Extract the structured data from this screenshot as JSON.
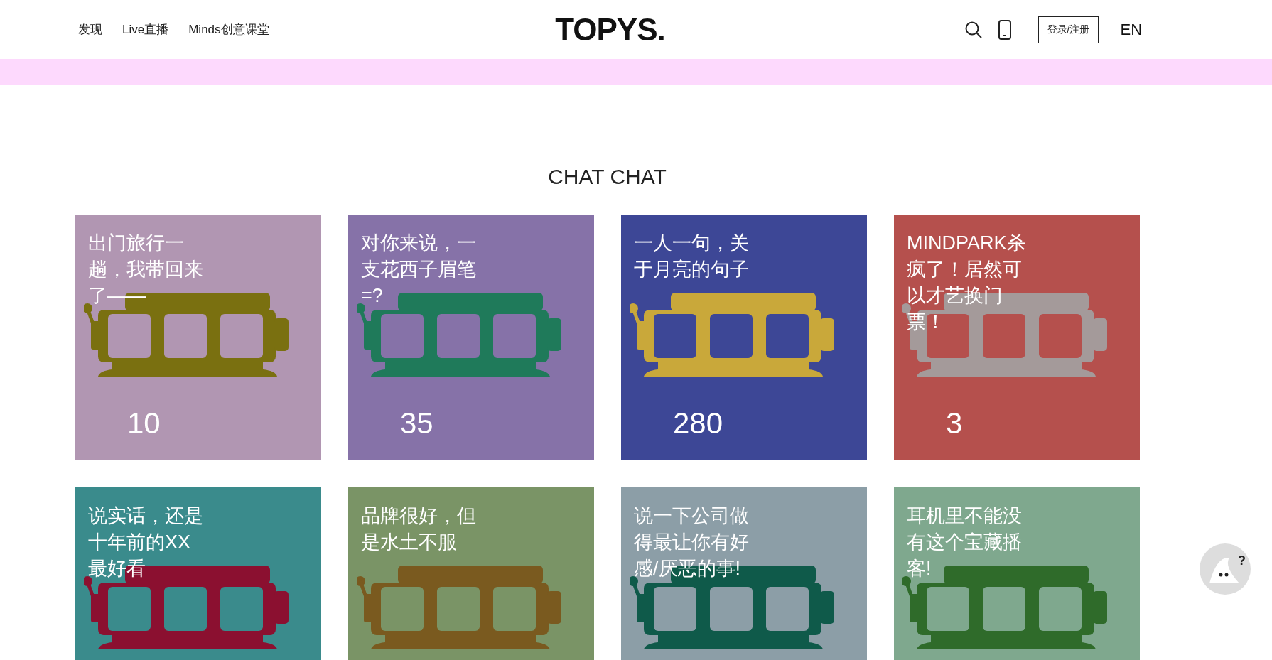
{
  "header": {
    "nav": [
      {
        "label": "发现"
      },
      {
        "label": "Live直播"
      },
      {
        "label": "Minds创意课堂"
      }
    ],
    "logo": "TOPYS.",
    "login": "登录/注册",
    "language": "EN"
  },
  "section": {
    "title": "CHAT CHAT"
  },
  "cards": [
    {
      "title": "出门旅行一趟，我带回来了——",
      "count": "10",
      "color": "#b196b2",
      "machine": {
        "color": "#7a7010"
      }
    },
    {
      "title": "对你来说，一支花西子眉笔=?",
      "count": "35",
      "color": "#8672a8",
      "machine": {
        "color": "#1f7a5a"
      }
    },
    {
      "title": "一人一句，关于月亮的句子",
      "count": "280",
      "color": "#3d4796",
      "machine": {
        "color": "#c9a83a"
      }
    },
    {
      "title": "MINDPARK杀疯了！居然可以才艺换门票！",
      "count": "3",
      "color": "#b5504d",
      "machine": {
        "color": "#a49a9a"
      }
    },
    {
      "title": "说实话，还是十年前的XX最好看",
      "color": "#3a8b8c",
      "machine": {
        "color": "#8b1030"
      }
    },
    {
      "title": "品牌很好，但是水土不服",
      "color": "#7a9466",
      "machine": {
        "color": "#7a5a1f"
      }
    },
    {
      "title": "说一下公司做得最让你有好感/厌恶的事!",
      "color": "#8c9ea7",
      "machine": {
        "color": "#0f5a4a"
      }
    },
    {
      "title": "耳机里不能没有这个宝藏播客!",
      "color": "#7fa88e",
      "machine": {
        "color": "#2f6b2a"
      }
    }
  ],
  "help": {
    "mark": "?"
  }
}
